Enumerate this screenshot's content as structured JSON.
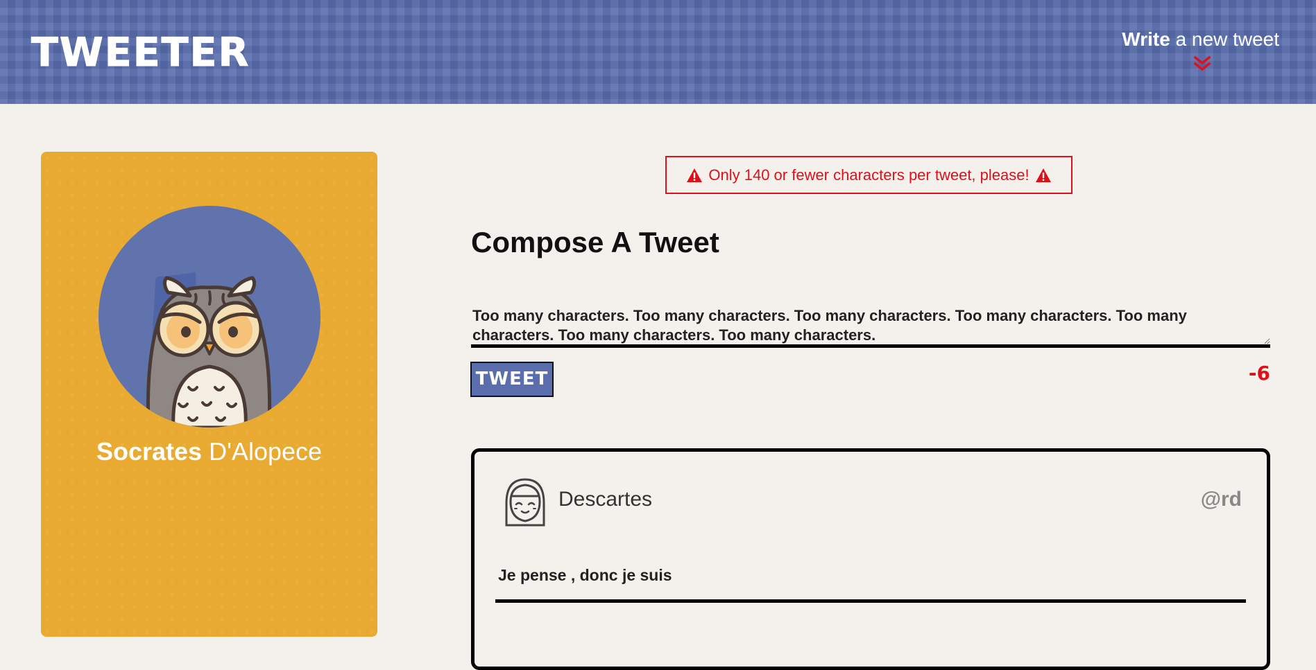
{
  "header": {
    "brand": "TWEETER",
    "write_strong": "Write",
    "write_light": " a new tweet",
    "chevron_icon": "double-chevron-down-icon",
    "chevron_color": "#e0101a"
  },
  "profile": {
    "first_name": "Socrates",
    "last_name": " D'Alopece",
    "avatar_icon": "owl-avatar",
    "card_color": "#e9aa32",
    "avatar_bg": "#6173ac"
  },
  "error": {
    "message": "Only 140 or fewer characters per tweet, please!",
    "icon": "warning-triangle-icon",
    "color": "#e0101a"
  },
  "compose": {
    "title": "Compose A Tweet",
    "textarea_value": "Too many characters. Too many characters. Too many characters. Too many characters. Too many characters. Too many characters. Too many characters.",
    "button_label": "TWEET",
    "counter": "-6"
  },
  "tweets": [
    {
      "name": "Descartes",
      "handle": "@rd",
      "content": "Je pense , donc je suis",
      "avatar_icon": "girl-face-avatar"
    }
  ]
}
